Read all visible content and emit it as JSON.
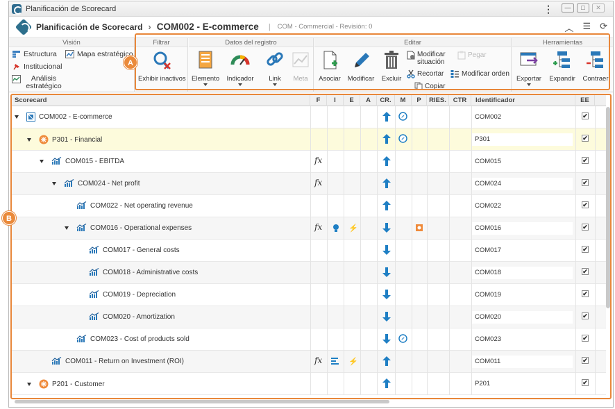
{
  "window": {
    "title": "Planificación de Scorecard"
  },
  "header": {
    "app_name": "Planificación de Scorecard",
    "separator": "›",
    "record_title": "COM002 - E-commerce",
    "bar": "|",
    "subtitle": "COM - Commercial - Revisión: 0"
  },
  "ribbon": {
    "vision": {
      "title": "Visión",
      "estructura": "Estructura",
      "mapa": "Mapa estratégico",
      "institucional": "Institucional",
      "analisis": "Análisis estratégico"
    },
    "filtrar": {
      "title": "Filtrar",
      "exhibir": "Exhibir inactivos"
    },
    "datos": {
      "title": "Datos del registro",
      "elemento": "Elemento",
      "indicador": "Indicador",
      "link": "Link",
      "meta": "Meta"
    },
    "editar": {
      "title": "Editar",
      "asociar": "Asociar",
      "modificar": "Modificar",
      "excluir": "Excluir",
      "modificar_situacion": "Modificar situación",
      "pegar": "Pegar",
      "recortar": "Recortar",
      "modificar_orden": "Modificar orden",
      "copiar": "Copiar"
    },
    "herramientas": {
      "title": "Herramientas",
      "exportar": "Exportar",
      "expandir": "Expandir",
      "contraer": "Contraer"
    }
  },
  "callouts": {
    "a": "A",
    "b": "B"
  },
  "grid": {
    "columns": [
      "Scorecard",
      "F",
      "I",
      "E",
      "A",
      "CR.",
      "M",
      "P",
      "RIES.",
      "CTR",
      "Identificador",
      "EE"
    ],
    "rows": [
      {
        "name": "COM002 - E-commerce",
        "icon": "scorecard-icon",
        "id": "COM002",
        "f": "",
        "i": "",
        "e": "",
        "cr": "up",
        "m": "compass"
      },
      {
        "name": "P301 - Financial",
        "icon": "perspective-icon",
        "id": "P301",
        "f": "",
        "i": "",
        "e": "",
        "cr": "up",
        "m": "compass"
      },
      {
        "name": "COM015 - EBITDA",
        "icon": "indicator-icon",
        "id": "COM015",
        "f": "fx",
        "i": "",
        "e": "",
        "cr": "up",
        "m": ""
      },
      {
        "name": "COM024 - Net profit",
        "icon": "indicator-icon",
        "id": "COM024",
        "f": "fx",
        "i": "",
        "e": "",
        "cr": "up",
        "m": ""
      },
      {
        "name": "COM022 - Net operating revenue",
        "icon": "indicator-icon",
        "id": "COM022",
        "f": "",
        "i": "",
        "e": "",
        "cr": "up",
        "m": ""
      },
      {
        "name": "COM016 - Operational expenses",
        "icon": "indicator-icon",
        "id": "COM016",
        "f": "fx",
        "i": "bulb",
        "e": "bolt",
        "cr": "down",
        "m": ""
      },
      {
        "name": "COM017 - General costs",
        "icon": "indicator-icon",
        "id": "COM017",
        "f": "",
        "i": "",
        "e": "",
        "cr": "down",
        "m": ""
      },
      {
        "name": "COM018 - Administrative costs",
        "icon": "indicator-icon",
        "id": "COM018",
        "f": "",
        "i": "",
        "e": "",
        "cr": "down",
        "m": ""
      },
      {
        "name": "COM019 - Depreciation",
        "icon": "indicator-icon",
        "id": "COM019",
        "f": "",
        "i": "",
        "e": "",
        "cr": "down",
        "m": ""
      },
      {
        "name": "COM020 - Amortization",
        "icon": "indicator-icon",
        "id": "COM020",
        "f": "",
        "i": "",
        "e": "",
        "cr": "down",
        "m": ""
      },
      {
        "name": "COM023 - Cost of products sold",
        "icon": "indicator-icon",
        "id": "COM023",
        "f": "",
        "i": "",
        "e": "",
        "cr": "down",
        "m": "compass"
      },
      {
        "name": "COM011 - Return on Investment (ROI)",
        "icon": "indicator-icon",
        "id": "COM011",
        "f": "fx",
        "i": "list",
        "e": "bolt",
        "cr": "up",
        "m": ""
      },
      {
        "name": "P201 - Customer",
        "icon": "perspective-icon",
        "id": "P201",
        "f": "",
        "i": "",
        "e": "",
        "cr": "up",
        "m": ""
      }
    ]
  },
  "colors": {
    "accent": "#e8873a",
    "blue": "#1f7fc4",
    "selected_row": "#fdfbdc"
  },
  "glyphs": {
    "fx": "fx",
    "check": "✔",
    "bolt": "⚡",
    "dots": "⋮",
    "min": "—",
    "max": "□",
    "close": "✕",
    "up": "︿",
    "list": "☰",
    "refresh": "⟳"
  }
}
